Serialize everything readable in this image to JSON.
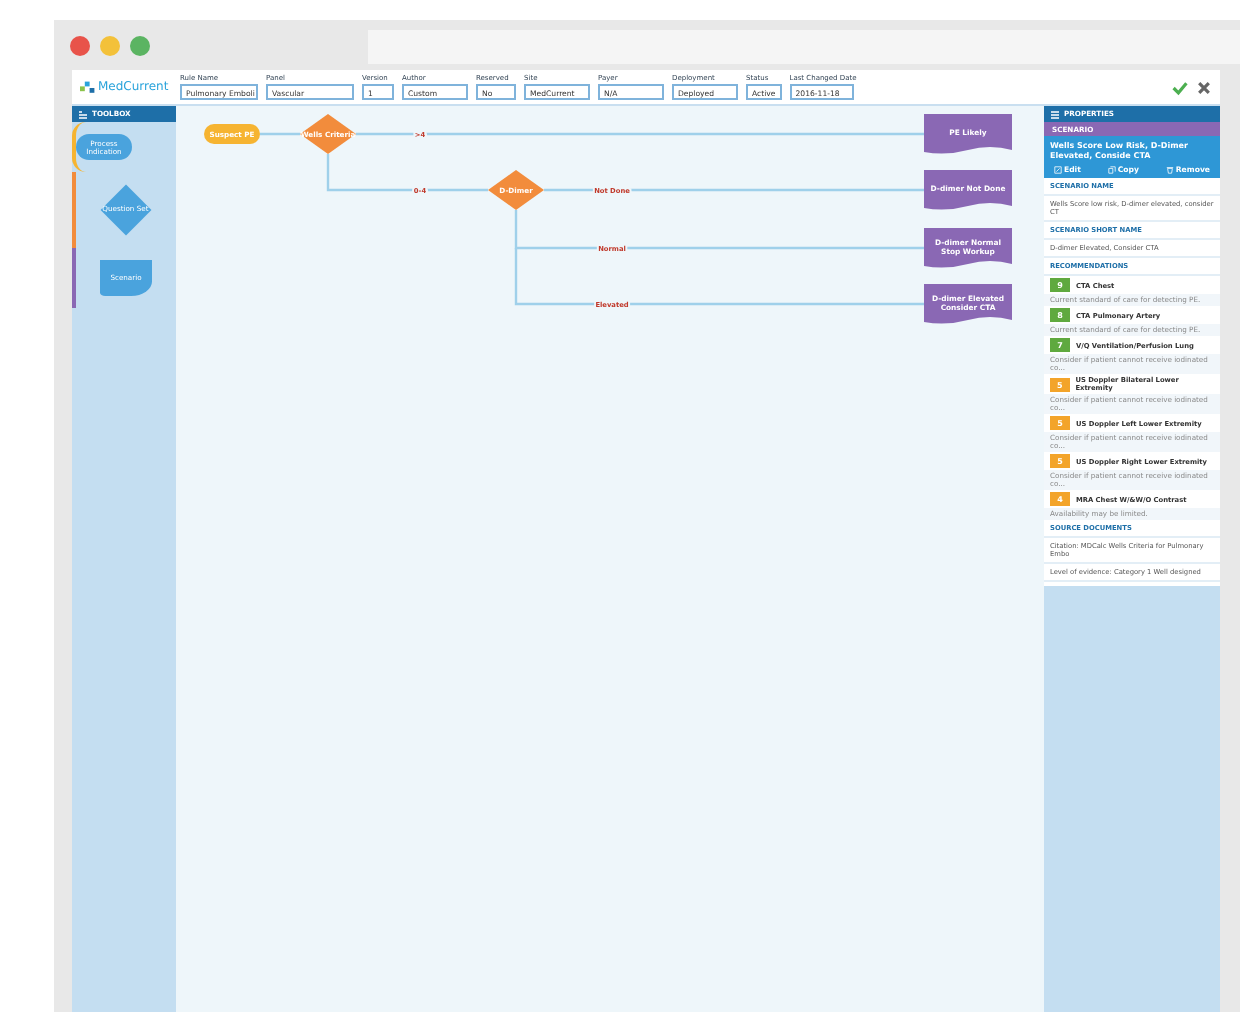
{
  "header": {
    "logo": "MedCurrent",
    "fields": [
      {
        "label": "Rule Name",
        "value": "Pulmonary Emboli"
      },
      {
        "label": "Panel",
        "value": "Vascular"
      },
      {
        "label": "Version",
        "value": "1"
      },
      {
        "label": "Author",
        "value": "Custom"
      },
      {
        "label": "Reserved",
        "value": "No"
      },
      {
        "label": "Site",
        "value": "MedCurrent"
      },
      {
        "label": "Payer",
        "value": "N/A"
      },
      {
        "label": "Deployment",
        "value": "Deployed"
      },
      {
        "label": "Status",
        "value": "Active"
      },
      {
        "label": "Last Changed Date",
        "value": "2016-11-18"
      }
    ]
  },
  "toolbox": {
    "title": "TOOLBOX",
    "items": [
      {
        "kind": "oval",
        "label": "Process Indication"
      },
      {
        "kind": "diamond",
        "label": "Question Set"
      },
      {
        "kind": "document",
        "label": "Scenario"
      }
    ]
  },
  "flow": {
    "nodes": [
      {
        "kind": "start",
        "lines": [
          "Suspect PE"
        ]
      },
      {
        "kind": "decision",
        "lines": [
          "Wells Criteria"
        ]
      },
      {
        "kind": "document",
        "lines": [
          "PE Likely"
        ]
      },
      {
        "kind": "decision",
        "lines": [
          "D-Dimer"
        ]
      },
      {
        "kind": "document",
        "lines": [
          "D-dimer Not Done"
        ]
      },
      {
        "kind": "document",
        "lines": [
          "D-dimer Normal",
          "Stop Workup"
        ]
      },
      {
        "kind": "document",
        "lines": [
          "D-dimer Elevated",
          "Consider CTA"
        ]
      }
    ],
    "edges": [
      {
        "label": ">4"
      },
      {
        "label": "0-4"
      },
      {
        "label": "Not Done"
      },
      {
        "label": "Normal"
      },
      {
        "label": "Elevated"
      }
    ]
  },
  "properties": {
    "title": "PROPERTIES",
    "type": "SCENARIO",
    "scenario_title": "Wells Score Low Risk, D-Dimer Elevated, Conside CTA",
    "actions": [
      {
        "kind": "edit",
        "label": "Edit"
      },
      {
        "kind": "copy",
        "label": "Copy"
      },
      {
        "kind": "remove",
        "label": "Remove"
      }
    ],
    "sections": [
      {
        "kind": "text",
        "heading": "SCENARIO NAME",
        "text": "Wells Score low risk, D-dimer elevated, consider CT"
      },
      {
        "kind": "text",
        "heading": "SCENARIO SHORT NAME",
        "text": "D-dimer Elevated, Consider CTA"
      },
      {
        "kind": "recommendations",
        "heading": "RECOMMENDATIONS",
        "items": [
          {
            "score": "9",
            "color": "#5fa93f",
            "title": "CTA Chest",
            "note": "Current standard of care for detecting PE."
          },
          {
            "score": "8",
            "color": "#5fa93f",
            "title": "CTA Pulmonary Artery",
            "note": "Current standard of care for detecting PE."
          },
          {
            "score": "7",
            "color": "#5fa93f",
            "title": "V/Q Ventilation/Perfusion Lung",
            "note": "Consider if patient cannot receive iodinated co..."
          },
          {
            "score": "5",
            "color": "#f3a42a",
            "title": "US Doppler Bilateral Lower Extremity",
            "note": "Consider if patient cannot receive iodinated co..."
          },
          {
            "score": "5",
            "color": "#f3a42a",
            "title": "US Doppler Left Lower Extremity",
            "note": "Consider if patient cannot receive iodinated co..."
          },
          {
            "score": "5",
            "color": "#f3a42a",
            "title": "US Doppler Right Lower Extremity",
            "note": "Consider if patient cannot receive iodinated co..."
          },
          {
            "score": "4",
            "color": "#f3a42a",
            "title": "MRA Chest W/&W/O Contrast",
            "note": "Availability may be limited."
          }
        ]
      },
      {
        "kind": "links",
        "heading": "SOURCE DOCUMENTS",
        "items": [
          "Citation: MDCalc Wells Criteria for Pulmonary Embo",
          "Level of evidence: Category 1 Well designed"
        ]
      }
    ]
  }
}
